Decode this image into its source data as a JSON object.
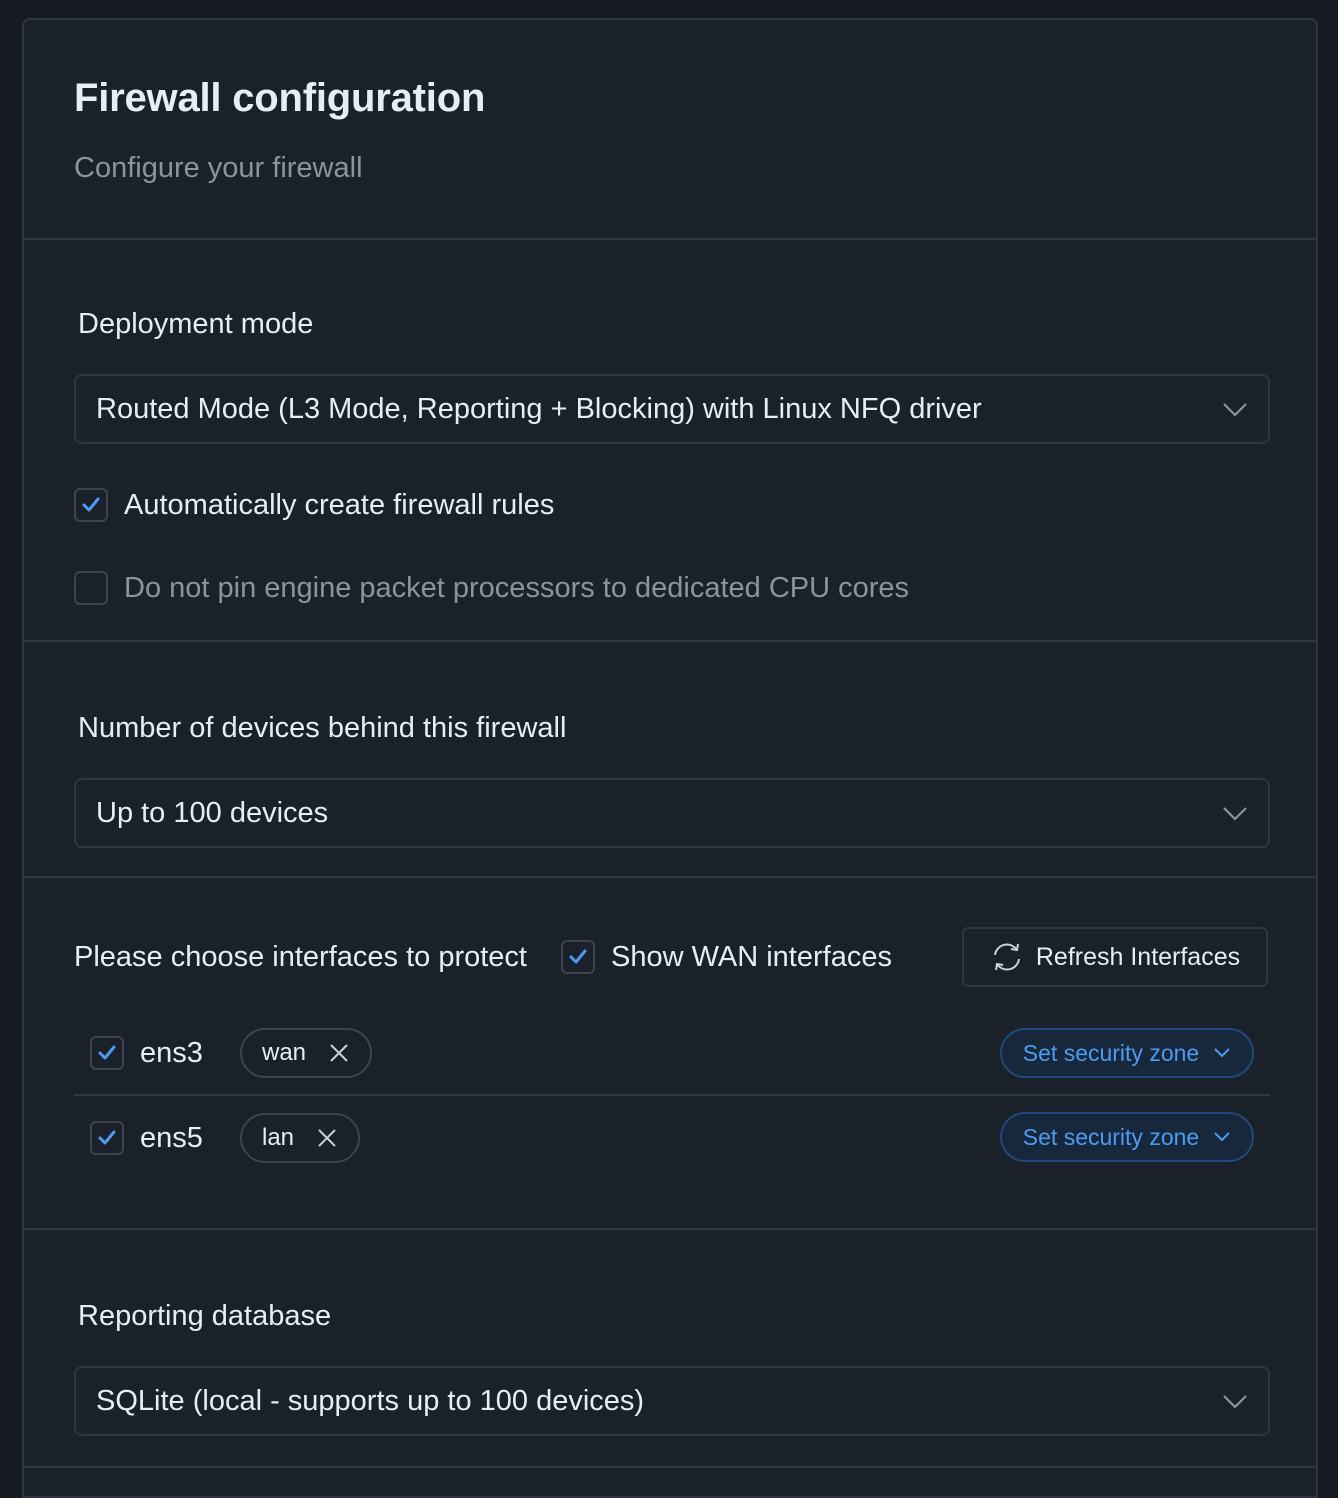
{
  "header": {
    "title": "Firewall configuration",
    "subtitle": "Configure your firewall"
  },
  "deployment": {
    "label": "Deployment mode",
    "selected": "Routed Mode (L3 Mode, Reporting + Blocking) with Linux NFQ driver",
    "auto_rules": {
      "label": "Automatically create firewall rules",
      "checked": true
    },
    "no_pin": {
      "label": "Do not pin engine packet processors to dedicated CPU cores",
      "checked": false
    }
  },
  "devices": {
    "label": "Number of devices behind this firewall",
    "selected": "Up to 100 devices"
  },
  "interfaces": {
    "title": "Please choose interfaces to protect",
    "show_wan": {
      "label": "Show WAN interfaces",
      "checked": true
    },
    "refresh_label": "Refresh Interfaces",
    "rows": [
      {
        "name": "ens3",
        "checked": true,
        "tag": "wan",
        "zone_label": "Set security zone"
      },
      {
        "name": "ens5",
        "checked": true,
        "tag": "lan",
        "zone_label": "Set security zone"
      }
    ]
  },
  "reporting": {
    "label": "Reporting database",
    "selected": "SQLite (local - supports up to 100 devices)"
  },
  "colors": {
    "background": "#161b22",
    "card": "#1b212b",
    "border": "#30363d",
    "accent": "#4d9bf0",
    "muted_text": "#8b949e"
  }
}
